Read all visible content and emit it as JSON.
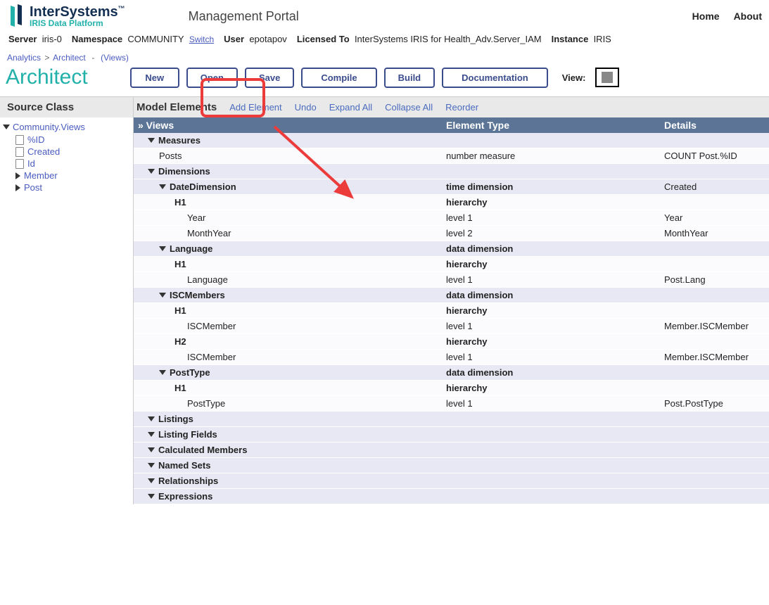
{
  "header": {
    "brand_top": "InterSystems",
    "brand_tm": "™",
    "brand_sub": "IRIS Data Platform",
    "mp": "Management Portal",
    "links": {
      "home": "Home",
      "about": "About"
    }
  },
  "infobar": {
    "server_l": "Server",
    "server_v": "iris-0",
    "ns_l": "Namespace",
    "ns_v": "COMMUNITY",
    "switch": "Switch",
    "user_l": "User",
    "user_v": "epotapov",
    "lic_l": "Licensed To",
    "lic_v": "InterSystems IRIS for Health_Adv.Server_IAM",
    "inst_l": "Instance",
    "inst_v": "IRIS"
  },
  "breadcrumb": {
    "a": "Analytics",
    "b": "Architect",
    "c": "(Views)"
  },
  "page_title": "Architect",
  "buttons": {
    "new": "New",
    "open": "Open",
    "save": "Save",
    "compile": "Compile",
    "build": "Build",
    "doc": "Documentation"
  },
  "view_label": "View:",
  "toolbar": {
    "source_class": "Source Class",
    "model_elements": "Model Elements",
    "add": "Add Element",
    "undo": "Undo",
    "expand": "Expand All",
    "collapse": "Collapse All",
    "reorder": "Reorder"
  },
  "sidebar": {
    "root": "Community.Views",
    "items": [
      "%ID",
      "Created",
      "Id",
      "Member",
      "Post"
    ]
  },
  "grid": {
    "headers": {
      "name": "» Views",
      "type": "Element Type",
      "details": "Details"
    },
    "sections": {
      "measures": "Measures",
      "dimensions": "Dimensions",
      "listings": "Listings",
      "listing_fields": "Listing Fields",
      "calc": "Calculated Members",
      "named": "Named Sets",
      "rel": "Relationships",
      "expr": "Expressions"
    },
    "rows": [
      {
        "kind": "section",
        "name": "Measures",
        "ind": 1
      },
      {
        "kind": "data",
        "name": "Posts",
        "type": "number measure",
        "details": "COUNT Post.%ID",
        "ind": 2
      },
      {
        "kind": "section",
        "name": "Dimensions",
        "ind": 1
      },
      {
        "kind": "dim",
        "name": "DateDimension",
        "type": "time dimension",
        "details": "Created",
        "ind": 2
      },
      {
        "kind": "data",
        "name": "H1",
        "type": "hierarchy",
        "details": "",
        "ind": 3,
        "bold": true
      },
      {
        "kind": "data",
        "name": "Year",
        "type": "level 1",
        "details": "Year",
        "ind": 4
      },
      {
        "kind": "data",
        "name": "MonthYear",
        "type": "level 2",
        "details": "MonthYear",
        "ind": 4
      },
      {
        "kind": "dim",
        "name": "Language",
        "type": "data dimension",
        "details": "",
        "ind": 2
      },
      {
        "kind": "data",
        "name": "H1",
        "type": "hierarchy",
        "details": "",
        "ind": 3,
        "bold": true
      },
      {
        "kind": "data",
        "name": "Language",
        "type": "level 1",
        "details": "Post.Lang",
        "ind": 4
      },
      {
        "kind": "dim",
        "name": "ISCMembers",
        "type": "data dimension",
        "details": "",
        "ind": 2
      },
      {
        "kind": "data",
        "name": "H1",
        "type": "hierarchy",
        "details": "",
        "ind": 3,
        "bold": true
      },
      {
        "kind": "data",
        "name": "ISCMember",
        "type": "level 1",
        "details": "Member.ISCMember",
        "ind": 4
      },
      {
        "kind": "data",
        "name": "H2",
        "type": "hierarchy",
        "details": "",
        "ind": 3,
        "bold": true
      },
      {
        "kind": "data",
        "name": "ISCMember",
        "type": "level 1",
        "details": "Member.ISCMember",
        "ind": 4
      },
      {
        "kind": "dim",
        "name": "PostType",
        "type": "data dimension",
        "details": "",
        "ind": 2
      },
      {
        "kind": "data",
        "name": "H1",
        "type": "hierarchy",
        "details": "",
        "ind": 3,
        "bold": true
      },
      {
        "kind": "data",
        "name": "PostType",
        "type": "level 1",
        "details": "Post.PostType",
        "ind": 4
      },
      {
        "kind": "group",
        "name": "Listings",
        "ind": 1
      },
      {
        "kind": "group",
        "name": "Listing Fields",
        "ind": 1
      },
      {
        "kind": "group",
        "name": "Calculated Members",
        "ind": 1
      },
      {
        "kind": "group",
        "name": "Named Sets",
        "ind": 1
      },
      {
        "kind": "group",
        "name": "Relationships",
        "ind": 1
      },
      {
        "kind": "group",
        "name": "Expressions",
        "ind": 1
      }
    ]
  }
}
